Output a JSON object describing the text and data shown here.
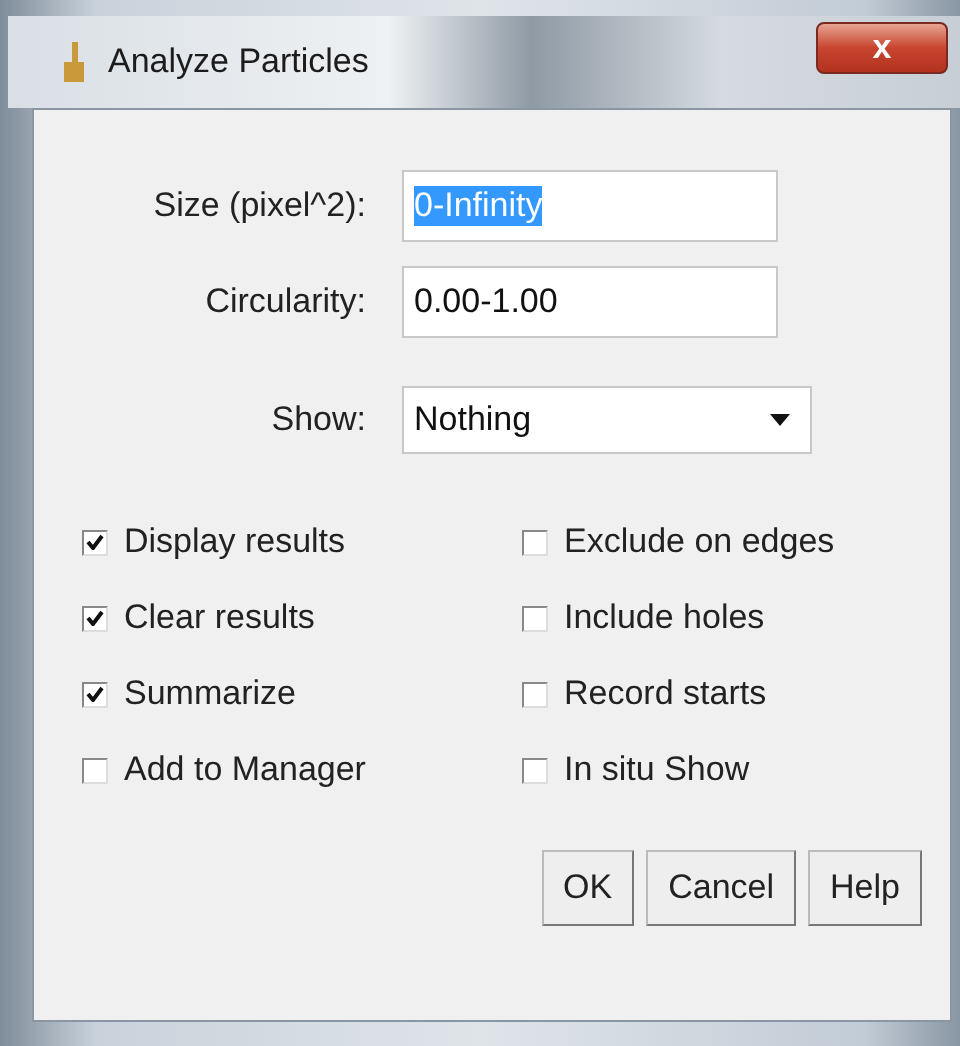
{
  "window": {
    "title": "Analyze Particles",
    "close": "x"
  },
  "fields": [
    {
      "kind": "text",
      "label": "Size (pixel^2):",
      "value": "0-Infinity",
      "selected": true
    },
    {
      "kind": "text",
      "label": "Circularity:",
      "value": "0.00-1.00",
      "selected": false
    },
    {
      "kind": "select",
      "label": "Show:",
      "value": "Nothing",
      "selected": false
    }
  ],
  "options": [
    {
      "label": "Display results",
      "checked": true
    },
    {
      "label": "Exclude on edges",
      "checked": false
    },
    {
      "label": "Clear results",
      "checked": true
    },
    {
      "label": "Include holes",
      "checked": false
    },
    {
      "label": "Summarize",
      "checked": true
    },
    {
      "label": "Record starts",
      "checked": false
    },
    {
      "label": "Add to Manager",
      "checked": false
    },
    {
      "label": "In situ Show",
      "checked": false
    }
  ],
  "buttons": [
    "OK",
    "Cancel",
    "Help"
  ]
}
